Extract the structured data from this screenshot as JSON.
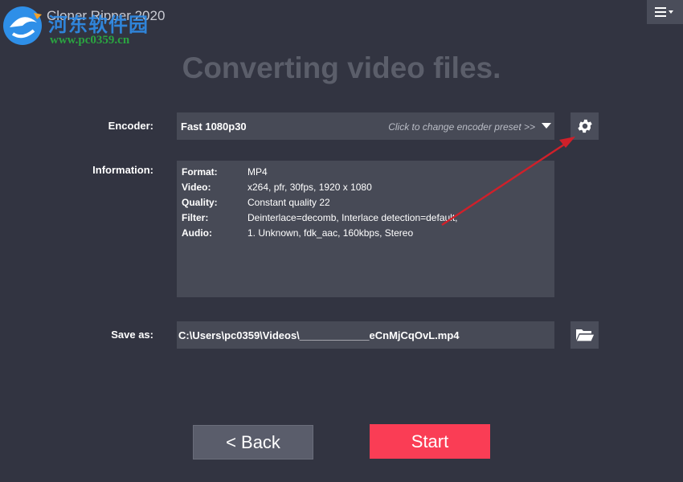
{
  "app": {
    "title": "Cloner Ripper 2020",
    "watermark_name": "河东软件园",
    "watermark_url": "www.pc0359.cn"
  },
  "heading": "Converting video files.",
  "encoder": {
    "label": "Encoder:",
    "value": "Fast 1080p30",
    "hint": "Click to change encoder preset >>"
  },
  "information": {
    "label": "Information:",
    "rows": [
      {
        "key": "Format:",
        "value": "MP4"
      },
      {
        "key": "Video:",
        "value": "x264, pfr, 30fps, 1920 x 1080"
      },
      {
        "key": "Quality:",
        "value": "Constant quality 22"
      },
      {
        "key": "Filter:",
        "value": "Deinterlace=decomb, Interlace detection=default,"
      },
      {
        "key": "Audio:",
        "value": "1. Unknown, fdk_aac, 160kbps, Stereo"
      }
    ]
  },
  "save_as": {
    "label": "Save as:",
    "value": "C:\\Users\\pc0359\\Videos\\____________eCnMjCqOvL.mp4"
  },
  "buttons": {
    "back": "<  Back",
    "start": "Start"
  },
  "icons": {
    "menu": "hamburger-dropdown-icon",
    "settings": "gear-icon",
    "folder": "folder-open-icon"
  },
  "colors": {
    "background": "#323441",
    "field": "#474a56",
    "start": "#fa3d55",
    "annotation_arrow": "#d0202a"
  }
}
